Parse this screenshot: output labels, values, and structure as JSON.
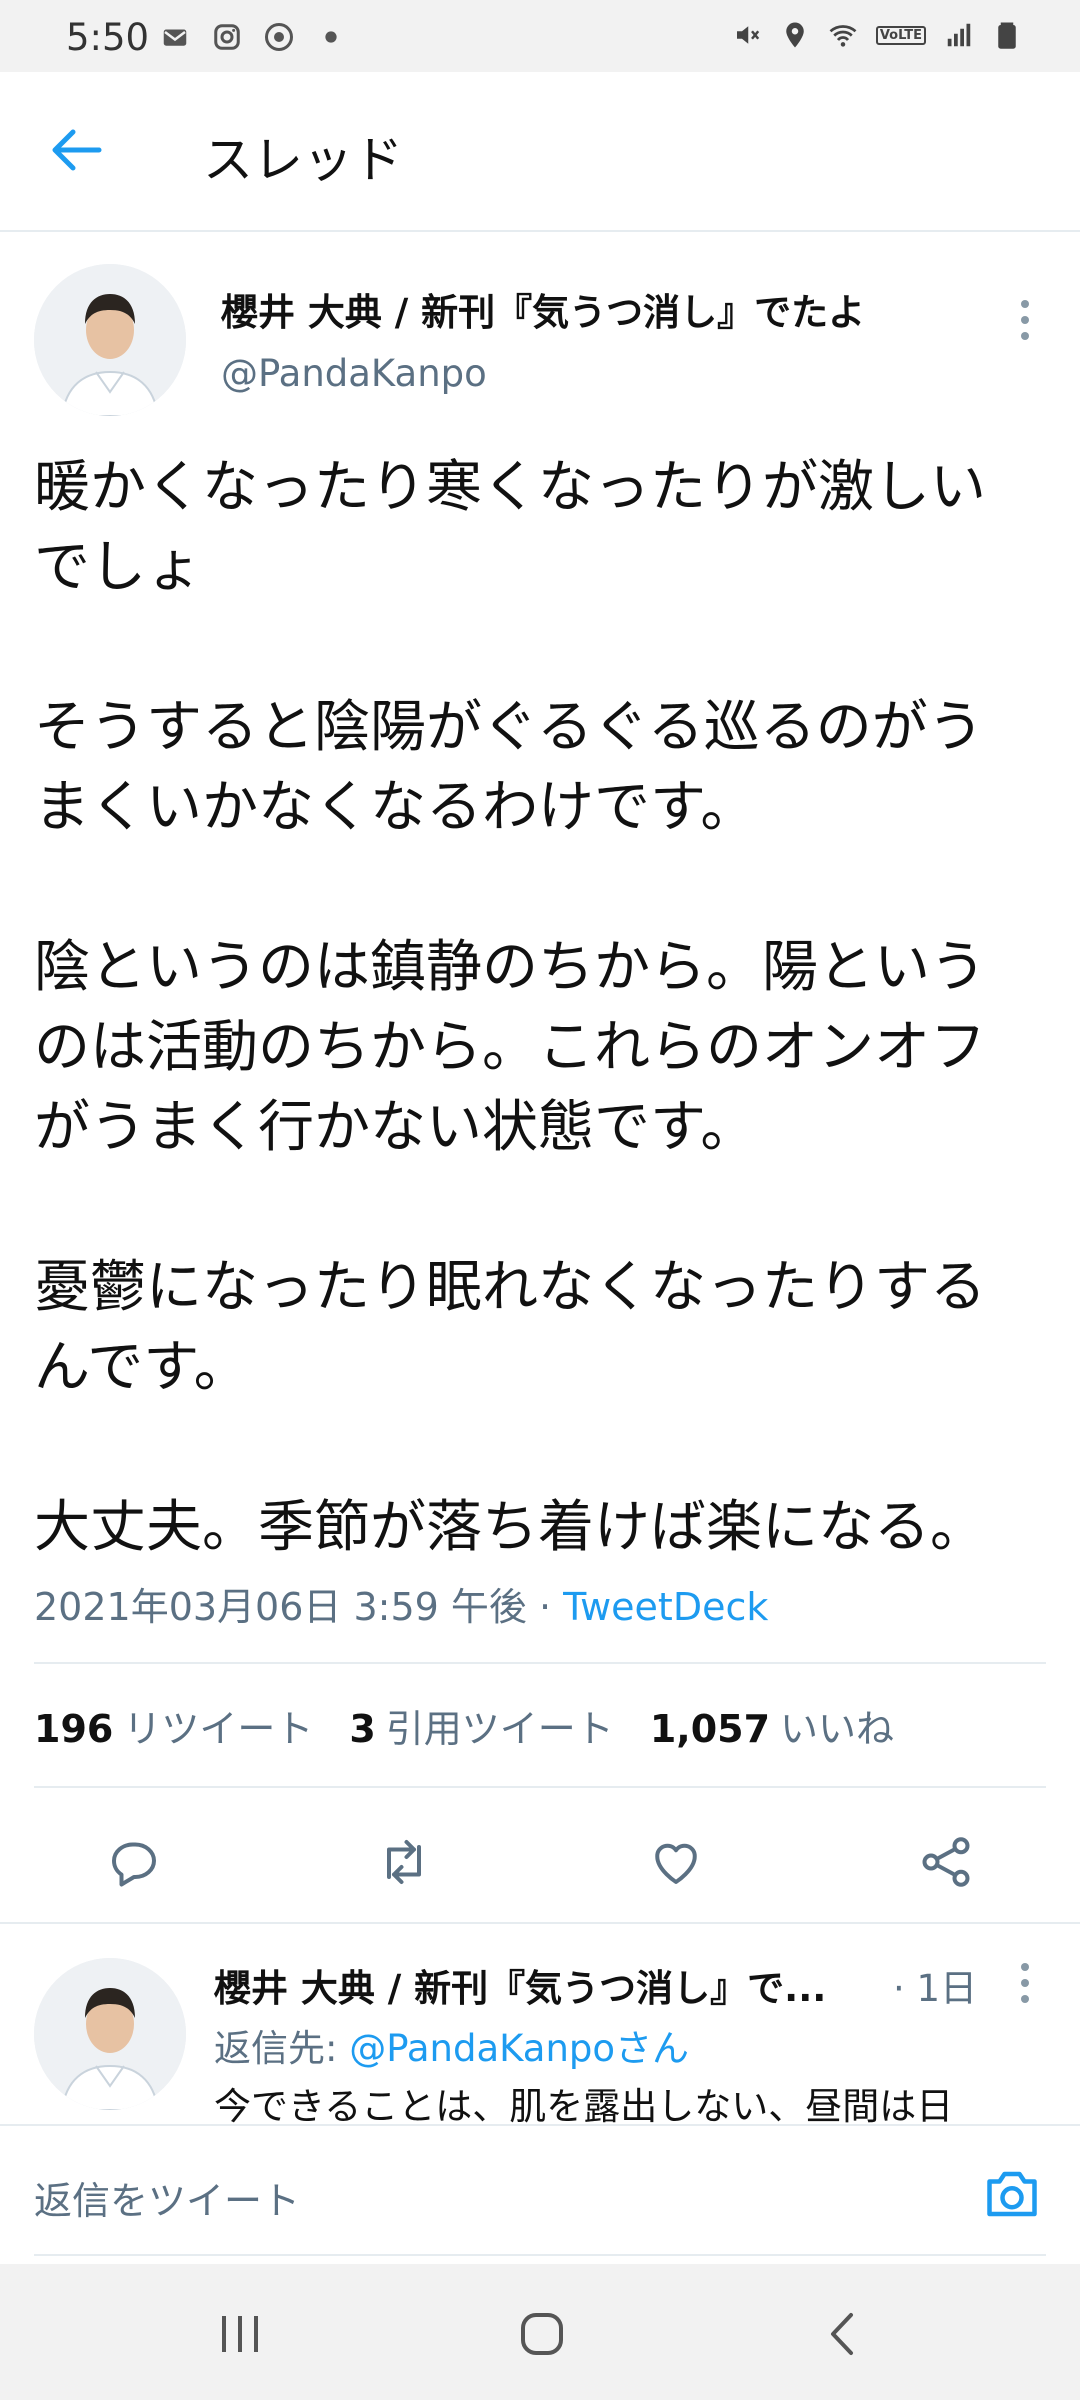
{
  "status_bar": {
    "time": "5:50",
    "left_icons": [
      "mail-icon",
      "instagram-icon",
      "chrome-icon",
      "dot-icon"
    ],
    "right_icons": [
      "mute-icon",
      "location-icon",
      "wifi-icon",
      "volte-icon",
      "signal-icon",
      "battery-icon"
    ],
    "volte_label": "VoLTE"
  },
  "header": {
    "title": "スレッド",
    "back_icon": "back-arrow-icon"
  },
  "tweet": {
    "author_name": "櫻井 大典 / 新刊『気うつ消し』でたよ",
    "author_handle": "@PandaKanpo",
    "paragraphs": [
      [
        "暖かくなったり寒くなったりが激しい",
        "でしょ"
      ],
      [
        "そうすると陰陽がぐるぐる巡るのがう",
        "まくいかなくなるわけです。"
      ],
      [
        "陰というのは鎮静のちから。陽という",
        "のは活動のちから。これらのオンオフ",
        "がうまく行かない状態です。"
      ],
      [
        "憂鬱になったり眠れなくなったりする",
        "んです。"
      ],
      [
        "大丈夫。季節が落ち着けば楽になる。"
      ]
    ],
    "timestamp": "2021年03月06日 3:59 午後",
    "separator": " · ",
    "source": "TweetDeck",
    "stats": {
      "retweets_count": "196",
      "retweets_label": "リツイート",
      "quotes_count": "3",
      "quotes_label": "引用ツイート",
      "likes_count": "1,057",
      "likes_label": "いいね"
    }
  },
  "reply": {
    "author_name": "櫻井 大典 / 新刊『気うつ消し』で...",
    "time": "· 1日",
    "reply_to_label": "返信先: ",
    "reply_to_handle": "@PandaKanpoさん",
    "text": "今できることは、肌を露出しない、昼間は日"
  },
  "compose": {
    "placeholder": "返信をツイート"
  },
  "colors": {
    "accent": "#1d9bf0",
    "secondary_text": "#5b7083",
    "divider": "#e6ecf0"
  }
}
